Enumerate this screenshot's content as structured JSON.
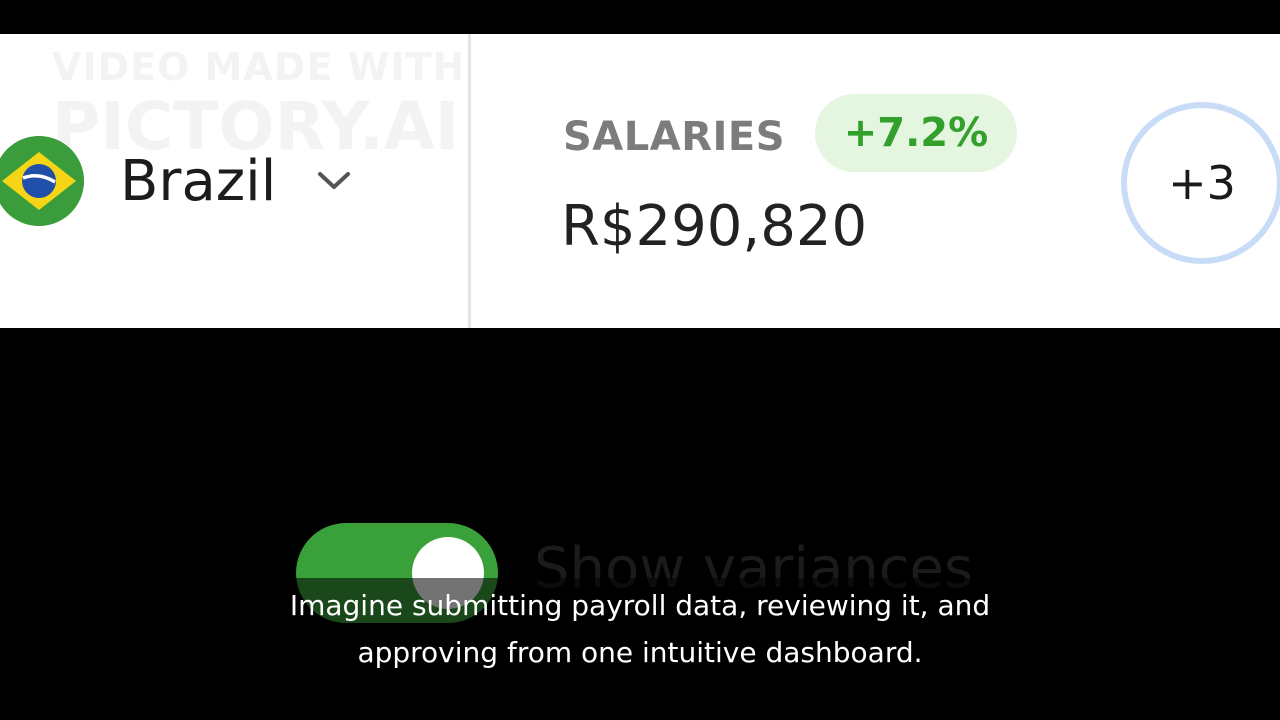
{
  "watermark": {
    "line1": "VIDEO MADE WITH",
    "line2": "PICTORY.AI"
  },
  "country": {
    "name": "Brazil",
    "flag_icon": "brazil-flag-icon",
    "flag_colors": {
      "green": "#3a9c3a",
      "yellow": "#f5d516",
      "blue": "#1f4fa8"
    }
  },
  "salaries": {
    "label": "SALARIES",
    "variance": "+7.2%",
    "amount": "R$290,820",
    "variance_color": "#33a02c",
    "variance_bg": "#e4f5e0"
  },
  "approvers": {
    "more_count": "+3"
  },
  "toggle": {
    "label": "Show variances",
    "on": true,
    "color": "#3aa03a"
  },
  "caption": {
    "line1": "Imagine submitting payroll data, reviewing it, and",
    "line2": "approving from one intuitive dashboard."
  }
}
